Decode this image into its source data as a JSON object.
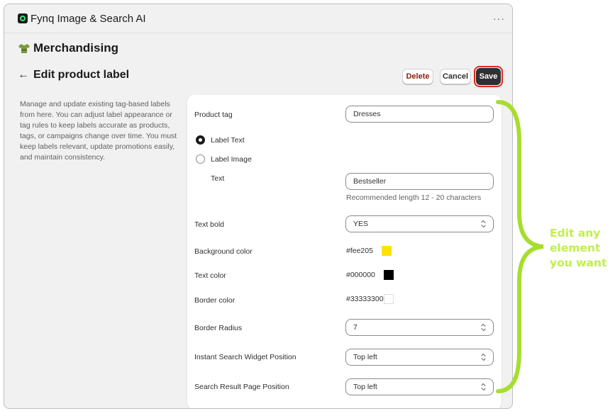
{
  "app": {
    "title": "Fynq Image & Search AI",
    "more_icon": "more-horizontal-icon"
  },
  "section": {
    "icon": "tshirt-icon",
    "label": "Merchandising"
  },
  "header": {
    "back_icon": "arrow-left-icon",
    "back_glyph": "←",
    "title": "Edit product label",
    "delete_label": "Delete",
    "cancel_label": "Cancel",
    "save_label": "Save"
  },
  "description": "Manage and update existing tag-based labels from here. You can adjust label appearance or tag rules to keep labels accurate as products, tags, or campaigns change over time. You must keep labels relevant, update promotions easily, and maintain consistency.",
  "form": {
    "product_tag": {
      "label": "Product tag",
      "value": "Dresses"
    },
    "label_type": {
      "options": [
        {
          "label": "Label Text",
          "checked": true
        },
        {
          "label": "Label Image",
          "checked": false
        }
      ]
    },
    "text": {
      "label": "Text",
      "value": "Bestseller",
      "hint": "Recommended length 12 - 20 characters"
    },
    "text_bold": {
      "label": "Text bold",
      "value": "YES"
    },
    "background_color": {
      "label": "Background color",
      "value": "#fee205",
      "swatch": "#fee205"
    },
    "text_color": {
      "label": "Text color",
      "value": "#000000",
      "swatch": "#000000"
    },
    "border_color": {
      "label": "Border color",
      "value": "#33333300",
      "swatch": "#ffffff"
    },
    "border_radius": {
      "label": "Border Radius",
      "value": "7"
    },
    "instant_search_position": {
      "label": "Instant Search Widget Position",
      "value": "Top left"
    },
    "search_result_position": {
      "label": "Search Result Page Position",
      "value": "Top left"
    }
  },
  "callout": {
    "line1": "Edit any",
    "line2": "element",
    "line3": "you want",
    "color": "#bff04c",
    "icon": "curly-brace-icon"
  },
  "colors": {
    "save_button": "#303030",
    "save_highlight": "#e4281f",
    "delete_text": "#8e1f0b",
    "page_bg": "#f1f1f1"
  }
}
